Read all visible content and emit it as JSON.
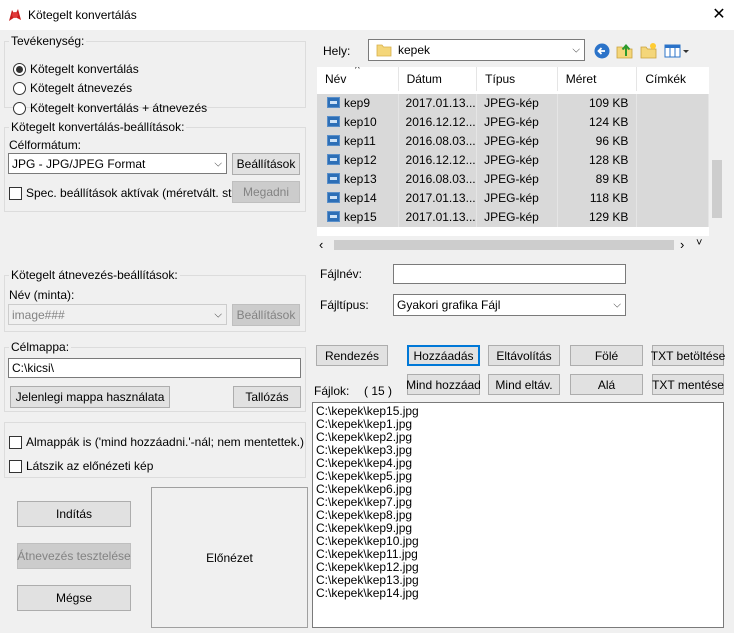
{
  "window": {
    "title": "Kötegelt konvertálás",
    "close_glyph": "✕"
  },
  "activity": {
    "legend": "Tevékenység:",
    "options": [
      "Kötegelt konvertálás",
      "Kötegelt átnevezés",
      "Kötegelt konvertálás + átnevezés"
    ],
    "selected_index": 0
  },
  "convert_settings": {
    "legend": "Kötegelt konvertálás-beállítások:",
    "format_label": "Célformátum:",
    "format_value": "JPG - JPG/JPEG Format",
    "settings_button": "Beállítások",
    "special_checkbox": "Spec. beállítások aktívak (méretvált. stb.)",
    "special_checked": false,
    "specify_button": "Megadni"
  },
  "rename_settings": {
    "legend": "Kötegelt átnevezés-beállítások:",
    "name_label": "Név (minta):",
    "name_value": "image###",
    "settings_button": "Beállítások"
  },
  "target": {
    "legend": "Célmappa:",
    "path": "C:\\kicsi\\",
    "use_current_button": "Jelenlegi mappa használata",
    "browse_button": "Tallózás"
  },
  "options": {
    "subfolders": "Almappák is ('mind hozzáadni.'-nál; nem mentettek.)",
    "subfolders_checked": false,
    "show_preview": "Látszik az előnézeti kép",
    "show_preview_checked": false
  },
  "actions": {
    "start": "Indítás",
    "test_rename": "Átnevezés tesztelése",
    "cancel": "Mégse"
  },
  "preview_label": "Előnézet",
  "browser": {
    "location_label": "Hely:",
    "location_value": "kepek",
    "columns": [
      "Név",
      "Dátum",
      "Típus",
      "Méret",
      "Címkék"
    ],
    "rows": [
      {
        "name": "kep9",
        "date": "2017.01.13....",
        "type": "JPEG-kép",
        "size": "109 KB",
        "tags": ""
      },
      {
        "name": "kep10",
        "date": "2016.12.12....",
        "type": "JPEG-kép",
        "size": "124 KB",
        "tags": ""
      },
      {
        "name": "kep11",
        "date": "2016.08.03....",
        "type": "JPEG-kép",
        "size": "96 KB",
        "tags": ""
      },
      {
        "name": "kep12",
        "date": "2016.12.12....",
        "type": "JPEG-kép",
        "size": "128 KB",
        "tags": ""
      },
      {
        "name": "kep13",
        "date": "2016.08.03....",
        "type": "JPEG-kép",
        "size": "89 KB",
        "tags": ""
      },
      {
        "name": "kep14",
        "date": "2017.01.13....",
        "type": "JPEG-kép",
        "size": "118 KB",
        "tags": ""
      },
      {
        "name": "kep15",
        "date": "2017.01.13....",
        "type": "JPEG-kép",
        "size": "129 KB",
        "tags": ""
      }
    ],
    "filename_label": "Fájlnév:",
    "filename_value": "",
    "filetype_label": "Fájltípus:",
    "filetype_value": "Gyakori grafika Fájl"
  },
  "list_buttons": {
    "sort": "Rendezés",
    "add": "Hozzáadás",
    "remove": "Eltávolítás",
    "up": "Fölé",
    "load_txt": "TXT betöltése",
    "add_all": "Mind hozzáad",
    "remove_all": "Mind eltáv.",
    "down": "Alá",
    "save_txt": "TXT mentése"
  },
  "files": {
    "label": "Fájlok:",
    "count": "( 15 )",
    "items": [
      "C:\\kepek\\kep15.jpg",
      "C:\\kepek\\kep1.jpg",
      "C:\\kepek\\kep2.jpg",
      "C:\\kepek\\kep3.jpg",
      "C:\\kepek\\kep4.jpg",
      "C:\\kepek\\kep5.jpg",
      "C:\\kepek\\kep6.jpg",
      "C:\\kepek\\kep7.jpg",
      "C:\\kepek\\kep8.jpg",
      "C:\\kepek\\kep9.jpg",
      "C:\\kepek\\kep10.jpg",
      "C:\\kepek\\kep11.jpg",
      "C:\\kepek\\kep12.jpg",
      "C:\\kepek\\kep13.jpg",
      "C:\\kepek\\kep14.jpg"
    ]
  },
  "colors": {
    "accent": "#0078d7",
    "selection": "#d9d9d9",
    "dialog_bg": "#f0f0f0"
  },
  "icons": {
    "app": "irfanview-icon",
    "folder": "folder-icon",
    "back": "back-arrow-icon",
    "up": "folder-up-icon",
    "new_folder": "new-folder-icon",
    "view_menu": "view-menu-icon"
  }
}
